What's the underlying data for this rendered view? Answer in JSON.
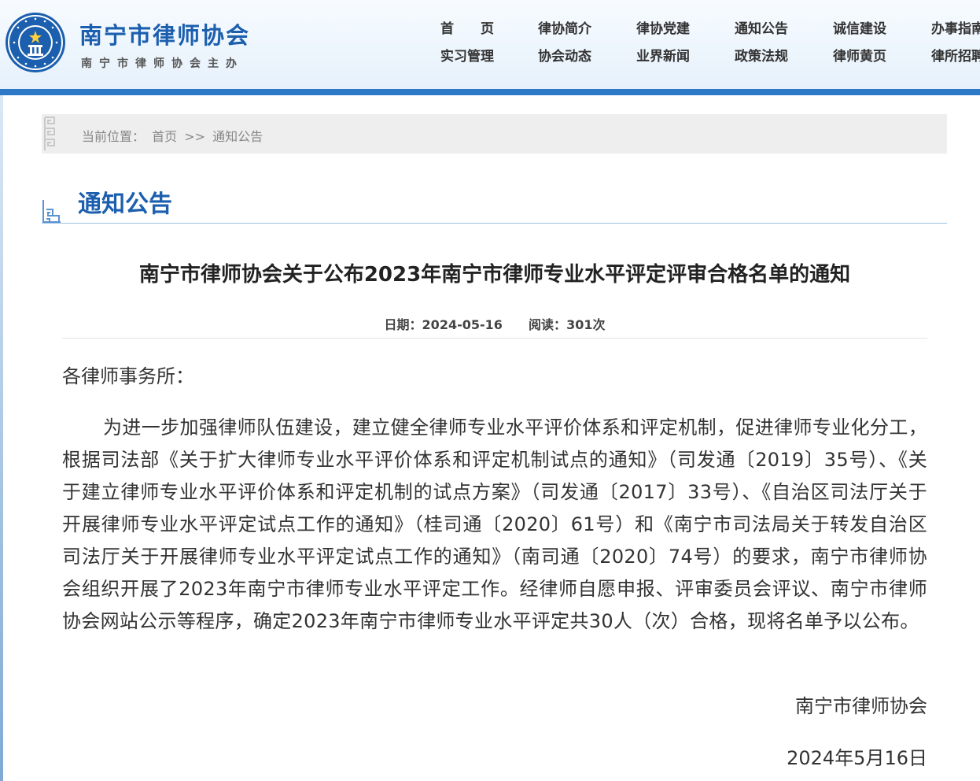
{
  "header": {
    "site_title": "南宁市律师协会",
    "site_subtitle": "南宁市律师协会主办",
    "nav_row1": [
      "首　　页",
      "律协简介",
      "律协党建",
      "通知公告",
      "诚信建设",
      "办事指南"
    ],
    "nav_row2": [
      "实习管理",
      "协会动态",
      "业界新闻",
      "政策法规",
      "律师黄页",
      "律所招聘"
    ]
  },
  "breadcrumb": {
    "prefix": "当前位置：",
    "home": "首页",
    "separator": ">>",
    "current": "通知公告"
  },
  "section": {
    "title": "通知公告"
  },
  "article": {
    "title": "南宁市律师协会关于公布2023年南宁市律师专业水平评定评审合格名单的通知",
    "date_label": "日期：",
    "date": "2024-05-16",
    "views_label": "阅读：",
    "views": "301次",
    "salutation": "各律师事务所：",
    "body": "为进一步加强律师队伍建设，建立健全律师专业水平评价体系和评定机制，促进律师专业化分工，根据司法部《关于扩大律师专业水平评价体系和评定机制试点的通知》（司发通〔2019〕35号）、《关于建立律师专业水平评价体系和评定机制的试点方案》（司发通〔2017〕33号）、《自治区司法厅关于开展律师专业水平评定试点工作的通知》（桂司通〔2020〕61号）和《南宁市司法局关于转发自治区司法厅关于开展律师专业水平评定试点工作的通知》（南司通〔2020〕74号）的要求，南宁市律师协会组织开展了2023年南宁市律师专业水平评定工作。经律师自愿申报、评审委员会评议、南宁市律师协会网站公示等程序，确定2023年南宁市律师专业水平评定共30人（次）合格，现将名单予以公布。",
    "signature": "南宁市律师协会",
    "sign_date": "2024年5月16日"
  },
  "colors": {
    "brand_blue": "#1c5fae",
    "header_bar": "#2d79c7"
  },
  "icons": {
    "logo": "nanning-lawyers-association-seal",
    "breadcrumb_decor": "greek-key-ornament",
    "section_decor": "greek-key-ornament"
  }
}
